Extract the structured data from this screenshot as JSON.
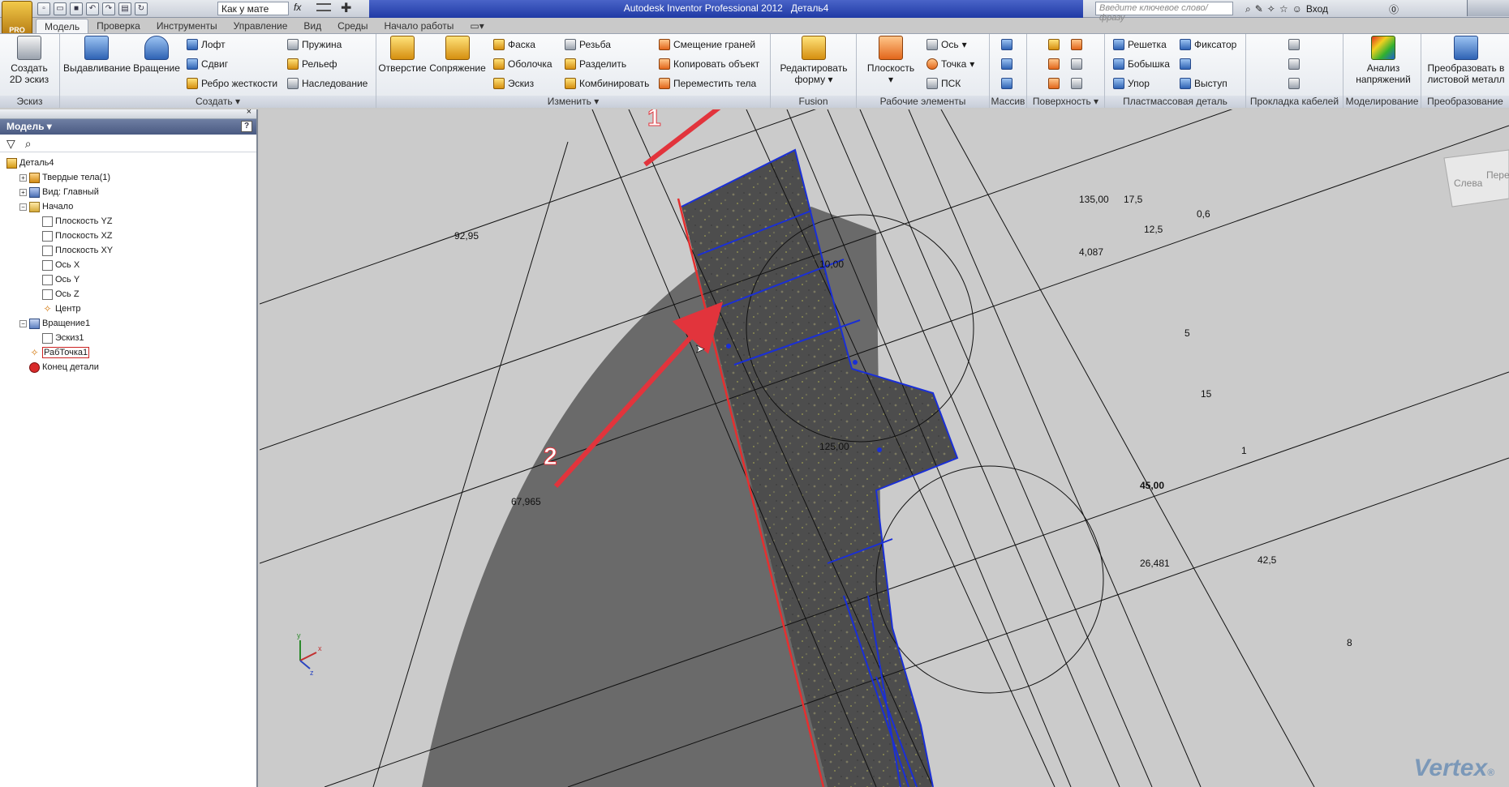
{
  "app": {
    "title": "Autodesk Inventor Professional 2012",
    "document": "Деталь4",
    "pro_badge": "PRO",
    "material": "Как у мате",
    "search_placeholder": "Введите ключевое слово/фразу",
    "login": "Вход",
    "fx": "fx"
  },
  "tabs": [
    "Модель",
    "Проверка",
    "Инструменты",
    "Управление",
    "Вид",
    "Среды",
    "Начало работы"
  ],
  "ribbon": {
    "panels": {
      "sketch": "Эскиз",
      "create": "Создать",
      "modify": "Изменить",
      "fusion": "Fusion",
      "work": "Рабочие элементы",
      "pattern": "Массив",
      "surface": "Поверхность",
      "plastic": "Пластмассовая деталь",
      "cable": "Прокладка кабелей",
      "sim": "Моделирование",
      "convert": "Преобразование"
    },
    "buttons": {
      "create_sketch": "Создать 2D эскиз",
      "extrude": "Выдавливание",
      "revolve": "Вращение",
      "loft": "Лофт",
      "sweep": "Сдвиг",
      "rib": "Ребро жесткости",
      "coil": "Пружина",
      "emboss": "Рельеф",
      "derive": "Наследование",
      "hole": "Отверстие",
      "fillet": "Сопряжение",
      "chamfer": "Фаска",
      "shell": "Оболочка",
      "draft": "Эскиз",
      "thread": "Резьба",
      "split": "Разделить",
      "combine": "Комбинировать",
      "thicken": "Смещение граней",
      "copy_object": "Копировать объект",
      "move_bodies": "Переместить тела",
      "edit_form": "Редактировать форму",
      "plane": "Плоскость",
      "axis": "Ось",
      "point": "Точка",
      "ucs": "ПСК",
      "grill": "Решетка",
      "boss": "Бобышка",
      "rest": "Упор",
      "snap_fit": "Фиксатор",
      "lip": "Выступ",
      "stress": "Анализ напряжений",
      "sheet_metal": "Преобразовать в листовой металл"
    }
  },
  "browser": {
    "title": "Модель",
    "help": "?",
    "tree": [
      {
        "label": "Деталь4",
        "level": 0,
        "icon": "part"
      },
      {
        "label": "Твердые тела(1)",
        "level": 1,
        "icon": "solid",
        "expander": "+"
      },
      {
        "label": "Вид: Главный",
        "level": 1,
        "icon": "view",
        "expander": "+"
      },
      {
        "label": "Начало",
        "level": 1,
        "icon": "folder",
        "expander": "−"
      },
      {
        "label": "Плоскость YZ",
        "level": 2,
        "icon": "plane"
      },
      {
        "label": "Плоскость XZ",
        "level": 2,
        "icon": "plane"
      },
      {
        "label": "Плоскость XY",
        "level": 2,
        "icon": "plane"
      },
      {
        "label": "Ось X",
        "level": 2,
        "icon": "plane"
      },
      {
        "label": "Ось Y",
        "level": 2,
        "icon": "plane"
      },
      {
        "label": "Ось Z",
        "level": 2,
        "icon": "plane"
      },
      {
        "label": "Центр",
        "level": 2,
        "icon": "pt"
      },
      {
        "label": "Вращение1",
        "level": 1,
        "icon": "rev",
        "expander": "−"
      },
      {
        "label": "Эскиз1",
        "level": 2,
        "icon": "plane"
      },
      {
        "label": "РабТочка1",
        "level": 1,
        "icon": "pt",
        "selected": true
      },
      {
        "label": "Конец детали",
        "level": 1,
        "icon": "end"
      }
    ]
  },
  "viewport": {
    "dimensions": [
      "92,95",
      "135,00",
      "17,5",
      "0,6",
      "12,5",
      "4,087",
      "10,00",
      "5",
      "15",
      "1",
      "45,00",
      "26,481",
      "42,5",
      "67,965",
      "125,00",
      "8"
    ],
    "callouts": [
      "1",
      "2"
    ],
    "viewcube": [
      "Слева",
      "Пере"
    ],
    "axes": [
      "x",
      "y",
      "z"
    ],
    "watermark": "Vertex",
    "watermark_mark": "®"
  },
  "colors": {
    "accent": "#1f3aa5",
    "callout": "#e2343c",
    "edge_selected": "#e52f2f",
    "sketch_blue": "#1a2fd6"
  }
}
